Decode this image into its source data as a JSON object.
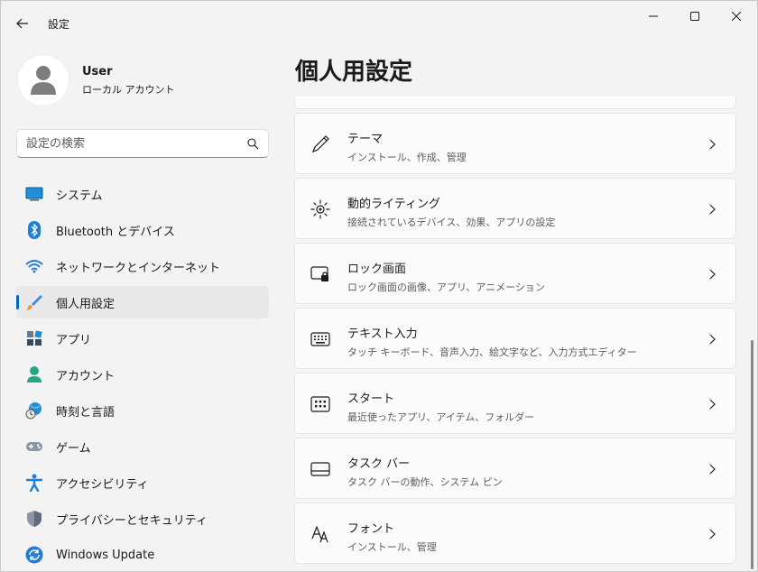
{
  "window": {
    "title": "設定"
  },
  "profile": {
    "name": "User",
    "account_type": "ローカル アカウント"
  },
  "search": {
    "placeholder": "設定の検索"
  },
  "sidebar": {
    "items": [
      {
        "label": "システム",
        "icon": "system-icon"
      },
      {
        "label": "Bluetooth とデバイス",
        "icon": "bluetooth-icon"
      },
      {
        "label": "ネットワークとインターネット",
        "icon": "wifi-icon"
      },
      {
        "label": "個人用設定",
        "icon": "brush-icon",
        "active": true
      },
      {
        "label": "アプリ",
        "icon": "apps-icon"
      },
      {
        "label": "アカウント",
        "icon": "account-icon"
      },
      {
        "label": "時刻と言語",
        "icon": "time-language-icon"
      },
      {
        "label": "ゲーム",
        "icon": "gamepad-icon"
      },
      {
        "label": "アクセシビリティ",
        "icon": "accessibility-icon"
      },
      {
        "label": "プライバシーとセキュリティ",
        "icon": "shield-icon"
      },
      {
        "label": "Windows Update",
        "icon": "update-icon"
      }
    ]
  },
  "main": {
    "title": "個人用設定",
    "cards": [
      {
        "title": "テーマ",
        "subtitle": "インストール、作成、管理",
        "icon": "pen-icon"
      },
      {
        "title": "動的ライティング",
        "subtitle": "接続されているデバイス、効果、アプリの設定",
        "icon": "lighting-icon"
      },
      {
        "title": "ロック画面",
        "subtitle": "ロック画面の画像、アプリ、アニメーション",
        "icon": "lock-screen-icon"
      },
      {
        "title": "テキスト入力",
        "subtitle": "タッチ キーボード、音声入力、絵文字など、入力方式エディター",
        "icon": "keyboard-icon"
      },
      {
        "title": "スタート",
        "subtitle": "最近使ったアプリ、アイテム、フォルダー",
        "icon": "start-icon"
      },
      {
        "title": "タスク バー",
        "subtitle": "タスク バーの動作、システム ピン",
        "icon": "taskbar-icon"
      },
      {
        "title": "フォント",
        "subtitle": "インストール、管理",
        "icon": "font-icon"
      }
    ]
  },
  "colors": {
    "accent": "#0067c0",
    "background": "#f3f3f3",
    "card": "#fbfbfb",
    "active_nav": "#e9e9e9"
  }
}
